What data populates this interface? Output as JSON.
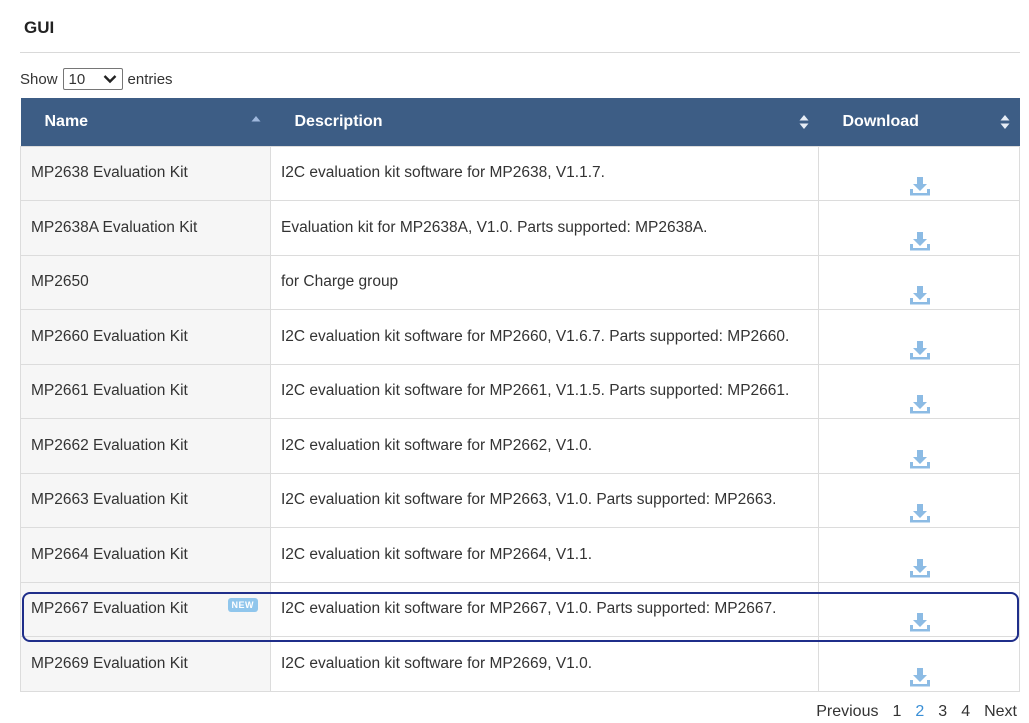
{
  "section_title": "GUI",
  "length_control": {
    "show_label": "Show",
    "selected": "10",
    "entries_label": "entries"
  },
  "table": {
    "headers": {
      "name": "Name",
      "description": "Description",
      "download": "Download"
    },
    "rows": [
      {
        "name": "MP2638 Evaluation Kit",
        "description": "I2C evaluation kit software for MP2638, V1.1.7.",
        "is_new": false
      },
      {
        "name": "MP2638A Evaluation Kit",
        "description": "Evaluation kit for MP2638A, V1.0. Parts supported: MP2638A.",
        "is_new": false
      },
      {
        "name": "MP2650",
        "description": "for Charge group",
        "is_new": false
      },
      {
        "name": "MP2660 Evaluation Kit",
        "description": "I2C evaluation kit software for MP2660, V1.6.7. Parts supported: MP2660.",
        "is_new": false
      },
      {
        "name": "MP2661 Evaluation Kit",
        "description": "I2C evaluation kit software for MP2661, V1.1.5. Parts supported: MP2661.",
        "is_new": false
      },
      {
        "name": "MP2662 Evaluation Kit",
        "description": "I2C evaluation kit software for MP2662, V1.0.",
        "is_new": false
      },
      {
        "name": "MP2663 Evaluation Kit",
        "description": "I2C evaluation kit software for MP2663, V1.0. Parts supported: MP2663.",
        "is_new": false
      },
      {
        "name": "MP2664 Evaluation Kit",
        "description": "I2C evaluation kit software for MP2664, V1.1.",
        "is_new": false
      },
      {
        "name": "MP2667 Evaluation Kit",
        "description": "I2C evaluation kit software for MP2667, V1.0. Parts supported: MP2667.",
        "is_new": true
      },
      {
        "name": "MP2669 Evaluation Kit",
        "description": "I2C evaluation kit software for MP2669, V1.0.",
        "is_new": false
      }
    ],
    "new_badge_label": "NEW",
    "highlighted_row": 8
  },
  "pagination": {
    "previous": "Previous",
    "pages": [
      "1",
      "2",
      "3",
      "4"
    ],
    "current": "2",
    "next": "Next"
  },
  "icons": {
    "download": "download-icon",
    "sort": "sort-icon",
    "dropdown": "chevron-down-icon"
  },
  "colors": {
    "header_bg": "#3d5d85",
    "download_icon": "#8cbbe4",
    "highlight_border": "#1f2e8a",
    "current_page": "#3a8fd6",
    "new_badge": "#90c6ec"
  }
}
